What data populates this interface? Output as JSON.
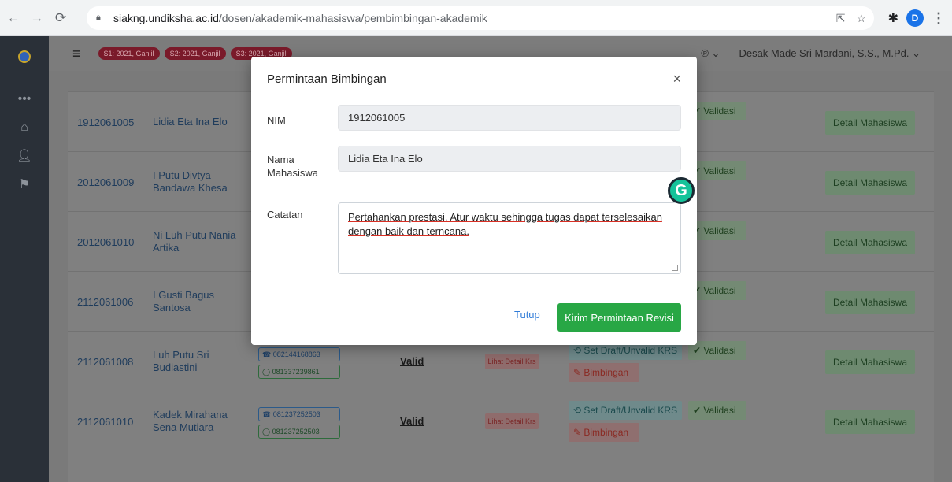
{
  "browser": {
    "url_host": "siakng.undiksha.ac.id",
    "url_path": "/dosen/akademik-mahasiswa/pembimbingan-akademik",
    "profile_initial": "D"
  },
  "topbar": {
    "semesters": [
      "S1: 2021, Ganjil",
      "S2: 2021, Ganjil",
      "S3: 2021, Ganjil"
    ],
    "user_name": "Desak Made Sri Mardani, S.S., M.Pd."
  },
  "rows": [
    {
      "nim": "1912061005",
      "name": "Lidia Eta Ina Elo"
    },
    {
      "nim": "2012061009",
      "name": "I Putu Divtya Bandawa Khesa"
    },
    {
      "nim": "2012061010",
      "name": "Ni Luh Putu Nania Artika"
    },
    {
      "nim": "2112061006",
      "name": "I Gusti Bagus Santosa"
    },
    {
      "nim": "2112061008",
      "name": "Luh Putu Sri Budiastini",
      "phone": "082144168863",
      "wa": "081337239861",
      "status": "Valid"
    },
    {
      "nim": "2112061010",
      "name": "Kadek Mirahana Sena Mutiara",
      "phone": "081237252503",
      "wa": "081237252503",
      "status": "Valid"
    }
  ],
  "row_buttons": {
    "validasi": "Validasi",
    "detail": "Detail Mahasiswa",
    "krs": "Lihat Detail Krs",
    "set_draft": "Set Draft/Unvalid KRS",
    "bimbingan": "Bimbingan"
  },
  "modal": {
    "title": "Permintaan Bimbingan",
    "nim_label": "NIM",
    "nim_value": "1912061005",
    "nama_label": "Nama Mahasiswa",
    "nama_value": "Lidia Eta Ina Elo",
    "catatan_label": "Catatan",
    "catatan_value": "Pertahankan prestasi. Atur waktu sehingga tugas dapat terselesaikan dengan baik dan terncana.",
    "tutup_label": "Tutup",
    "kirim_label": "Kirim Permintaan Revisi"
  },
  "colors": {
    "primary_green": "#28a745",
    "link_blue": "#2f7bd8",
    "grammarly": "#15c39a"
  }
}
